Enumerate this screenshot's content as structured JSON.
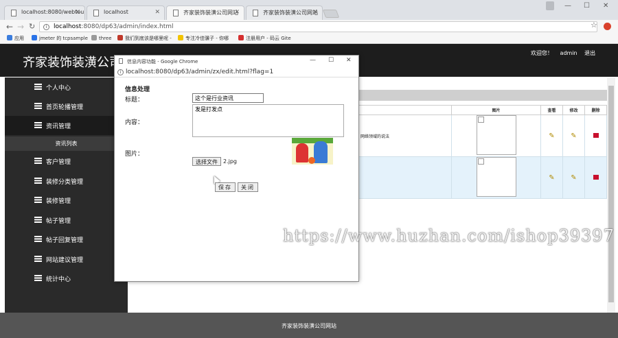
{
  "browser": {
    "tabs": [
      {
        "label": "localhost:8080/webtou",
        "active": false
      },
      {
        "label": "localhost",
        "active": false
      },
      {
        "label": "齐家装饰装潢公司网站",
        "active": true
      },
      {
        "label": "齐家装饰装潢公司网站",
        "active": false
      }
    ],
    "url_host": "localhost",
    "url_path": ":8080/dp63/admin/index.html",
    "bookmarks": [
      "应用",
      "jmeter 的 tcpsample",
      "three",
      "我们到底该是哪里呢 -",
      "专注冷佳骥子 - 你哪",
      "注册用户 - 码云 Gite"
    ],
    "bookmark_colors": [
      "#3b7ddd",
      "#2a73e8",
      "#999999",
      "#c0392b",
      "#f2c300",
      "#d52f2f"
    ]
  },
  "app": {
    "site_title": "齐家装饰装潢公司网站",
    "welcome": "欢迎您！",
    "user": "admin",
    "logout": "退出",
    "footer": "齐家装饰装潢公司网站"
  },
  "sidebar": {
    "items": [
      {
        "label": "个人中心"
      },
      {
        "label": "首页轮播管理"
      },
      {
        "label": "资讯管理"
      },
      {
        "label": "客户管理"
      },
      {
        "label": "装修分类管理"
      },
      {
        "label": "装修管理"
      },
      {
        "label": "帖子管理"
      },
      {
        "label": "帖子回复管理"
      },
      {
        "label": "网站建议管理"
      },
      {
        "label": "统计中心"
      }
    ],
    "sub_item": "资讯列表"
  },
  "table": {
    "headers": [
      "图片",
      "查看",
      "修改",
      "删除"
    ],
    "rows": [
      {
        "text": "网络领域的说法"
      },
      {
        "text": ""
      }
    ]
  },
  "popup": {
    "window_title": "信息内容功能 - Google Chrome",
    "url": "localhost:8080/dp63/admin/zx/edit.html?flag=1",
    "form_heading": "信息处理",
    "title_label": "标题：",
    "title_value": "这个是行业资讯",
    "content_label": "内容：",
    "content_value": "发是打发点",
    "image_label": "图片：",
    "file_button": "选择文件",
    "file_name": "2.jpg",
    "save_button": "保存",
    "close_button": "关闭"
  },
  "watermark": "https://www.huzhan.com/ishop39397"
}
